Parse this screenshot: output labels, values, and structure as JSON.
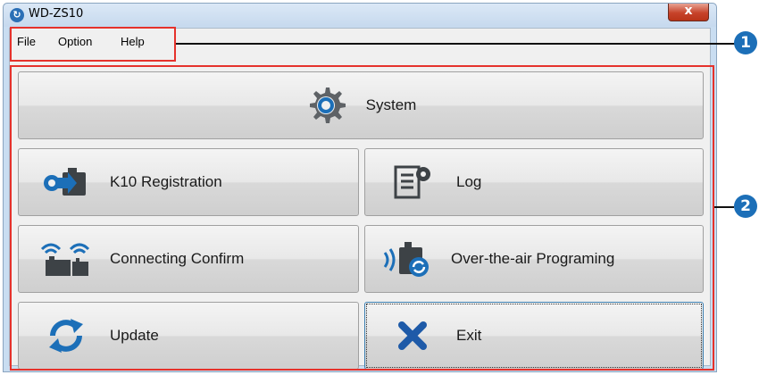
{
  "window": {
    "title": "WD-ZS10",
    "close_label": "x",
    "app_icon_glyph": "↻"
  },
  "menu": {
    "items": [
      {
        "label": "File"
      },
      {
        "label": "Option"
      },
      {
        "label": "Help"
      }
    ]
  },
  "buttons": {
    "system": {
      "label": "System",
      "icon": "gear-icon"
    },
    "k10_registration": {
      "label": "K10 Registration",
      "icon": "k10-register-icon"
    },
    "log": {
      "label": "Log",
      "icon": "log-scroll-icon"
    },
    "connecting_confirm": {
      "label": "Connecting Confirm",
      "icon": "wireless-devices-icon"
    },
    "ota_programming": {
      "label": "Over-the-air Programing",
      "icon": "ota-device-icon"
    },
    "update": {
      "label": "Update",
      "icon": "refresh-icon"
    },
    "exit": {
      "label": "Exit",
      "icon": "close-x-icon"
    }
  },
  "callouts": {
    "one": "1",
    "two": "2"
  },
  "colors": {
    "accent_blue": "#1c6fb8",
    "highlight_red": "#e5322c",
    "exit_x_blue": "#1e5aa8"
  }
}
